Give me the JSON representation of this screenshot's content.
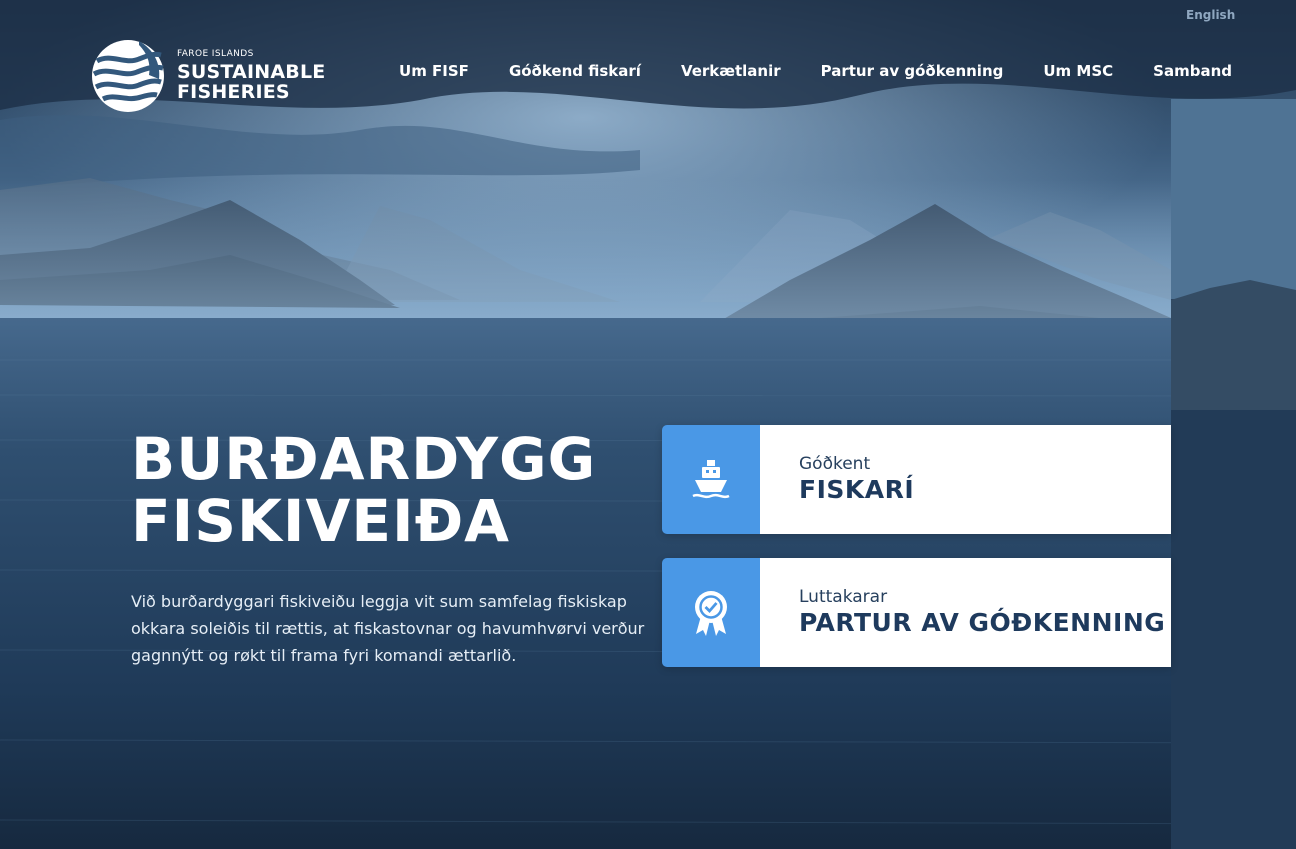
{
  "language_link": "English",
  "logo": {
    "small": "FAROE ISLANDS",
    "line1": "SUSTAINABLE",
    "line2": "FISHERIES"
  },
  "nav": {
    "items": [
      {
        "label": "Um FISF"
      },
      {
        "label": "Góðkend fiskarí"
      },
      {
        "label": "Verkætlanir"
      },
      {
        "label": "Partur av góðkenning"
      },
      {
        "label": "Um MSC"
      },
      {
        "label": "Samband"
      }
    ]
  },
  "hero": {
    "title_line1": "BURÐARDYGG",
    "title_line2": "FISKIVEIÐA",
    "text": "Við burðardyggari fiskiveiðu leggja vit sum samfelag fiskiskap okkara soleiðis til rættis, at fiskastovnar og havumhvørvi verður gagnnýtt og røkt til frama fyri komandi ættarlið."
  },
  "cards": [
    {
      "subtitle": "Góðkent",
      "title": "FISKARÍ",
      "icon": "ship-icon"
    },
    {
      "subtitle": "Luttakarar",
      "title": "PARTUR AV GÓÐKENNING",
      "icon": "award-badge-icon"
    }
  ],
  "colors": {
    "accent": "#4a98e6",
    "card_text": "#1e3a5d",
    "sky": "#6b93b8",
    "sea": "#1c3550"
  }
}
